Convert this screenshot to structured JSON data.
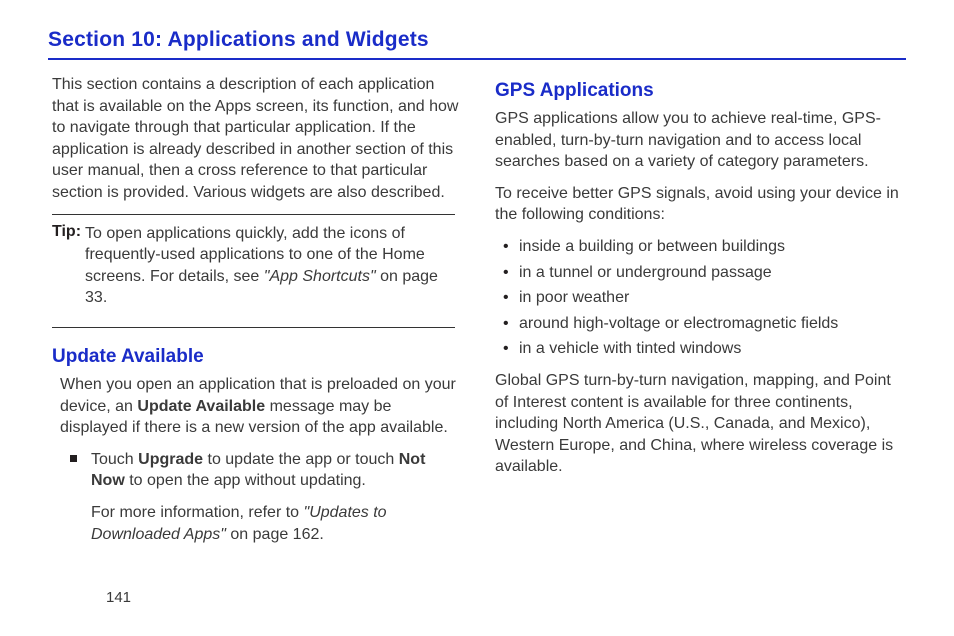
{
  "section_title": "Section 10:  Applications and Widgets",
  "page_number": "141",
  "left": {
    "intro": "This section contains a description of each application that is available on the Apps screen, its function, and how to navigate through that particular application. If the application is already described in another section of this user manual, then a cross reference to that particular section is provided. Various widgets are also described.",
    "tip": {
      "label": "Tip:",
      "body_a": "To open applications quickly, add the icons of frequently-used applications to one of the Home screens. For details, see ",
      "body_ref": "\"App Shortcuts\"",
      "body_b": " on page 33."
    },
    "update": {
      "heading": "Update Available",
      "p1_a": "When you open an application that is preloaded on your device, an ",
      "p1_bold": "Update Available",
      "p1_b": " message may be displayed if there is a new version of the app available.",
      "step_a": "Touch ",
      "step_bold1": "Upgrade",
      "step_b": " to update the app or touch ",
      "step_bold2": "Not Now",
      "step_c": " to open the app without updating.",
      "more_a": "For more information, refer to ",
      "more_ref": "\"Updates to Downloaded Apps\"",
      "more_b": "  on page 162."
    }
  },
  "right": {
    "heading": "GPS Applications",
    "p1": "GPS applications allow you to achieve real-time, GPS-enabled, turn-by-turn navigation and to access local searches based on a variety of category parameters.",
    "p2": "To receive better GPS signals, avoid using your device in the following conditions:",
    "bullets": [
      " inside a building or between buildings",
      "in a tunnel or underground passage",
      "in poor weather",
      "around high-voltage or electromagnetic fields",
      "in a vehicle with tinted windows"
    ],
    "p3": "Global GPS turn-by-turn navigation, mapping, and Point of Interest content is available for three continents, including North America (U.S., Canada, and Mexico), Western Europe, and China, where wireless coverage is available."
  }
}
